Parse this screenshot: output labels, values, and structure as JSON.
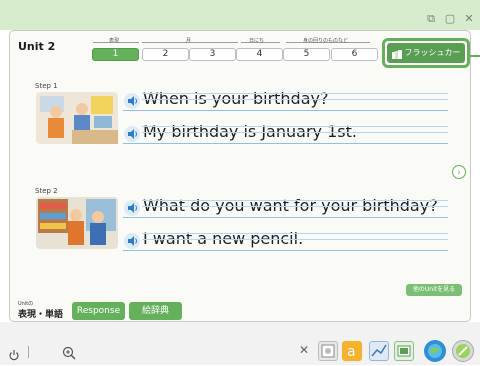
{
  "window": {
    "controls": [
      "⧉",
      "▢",
      "✕"
    ]
  },
  "unit": {
    "title": "Unit 2"
  },
  "tabs": {
    "group_labels": [
      "表現",
      "月",
      "日にち",
      "身の回りのものなど"
    ],
    "items": [
      {
        "label": "1",
        "active": true
      },
      {
        "label": "2",
        "active": false
      },
      {
        "label": "3",
        "active": false
      },
      {
        "label": "4",
        "active": false
      },
      {
        "label": "5",
        "active": false
      },
      {
        "label": "6",
        "active": false
      }
    ]
  },
  "flashcard_button": {
    "label": "フラッシュカード"
  },
  "steps": [
    {
      "label": "Step 1",
      "sentences": [
        "When is your birthday?",
        "My birthday is January 1st."
      ]
    },
    {
      "label": "Step 2",
      "sentences": [
        "What do you want for your birthday?",
        "I want a new pencil."
      ]
    }
  ],
  "next_button": {
    "glyph": "›"
  },
  "other_unit_button": {
    "label": "他のUnitを見る"
  },
  "bottom_tabs": {
    "unit_small": "Unitの",
    "expression": "表現・単語",
    "response": "Response",
    "dictionary": "絵辞典"
  },
  "colors": {
    "accent_green": "#64b05b",
    "titlebar": "#d7eccd"
  },
  "footer": {
    "close": "✕",
    "tools": [
      "clock-icon",
      "zoom-icon",
      "timer-icon",
      "alpha-icon",
      "chart-icon",
      "film-icon",
      "globe-icon",
      "pencil-icon"
    ]
  }
}
